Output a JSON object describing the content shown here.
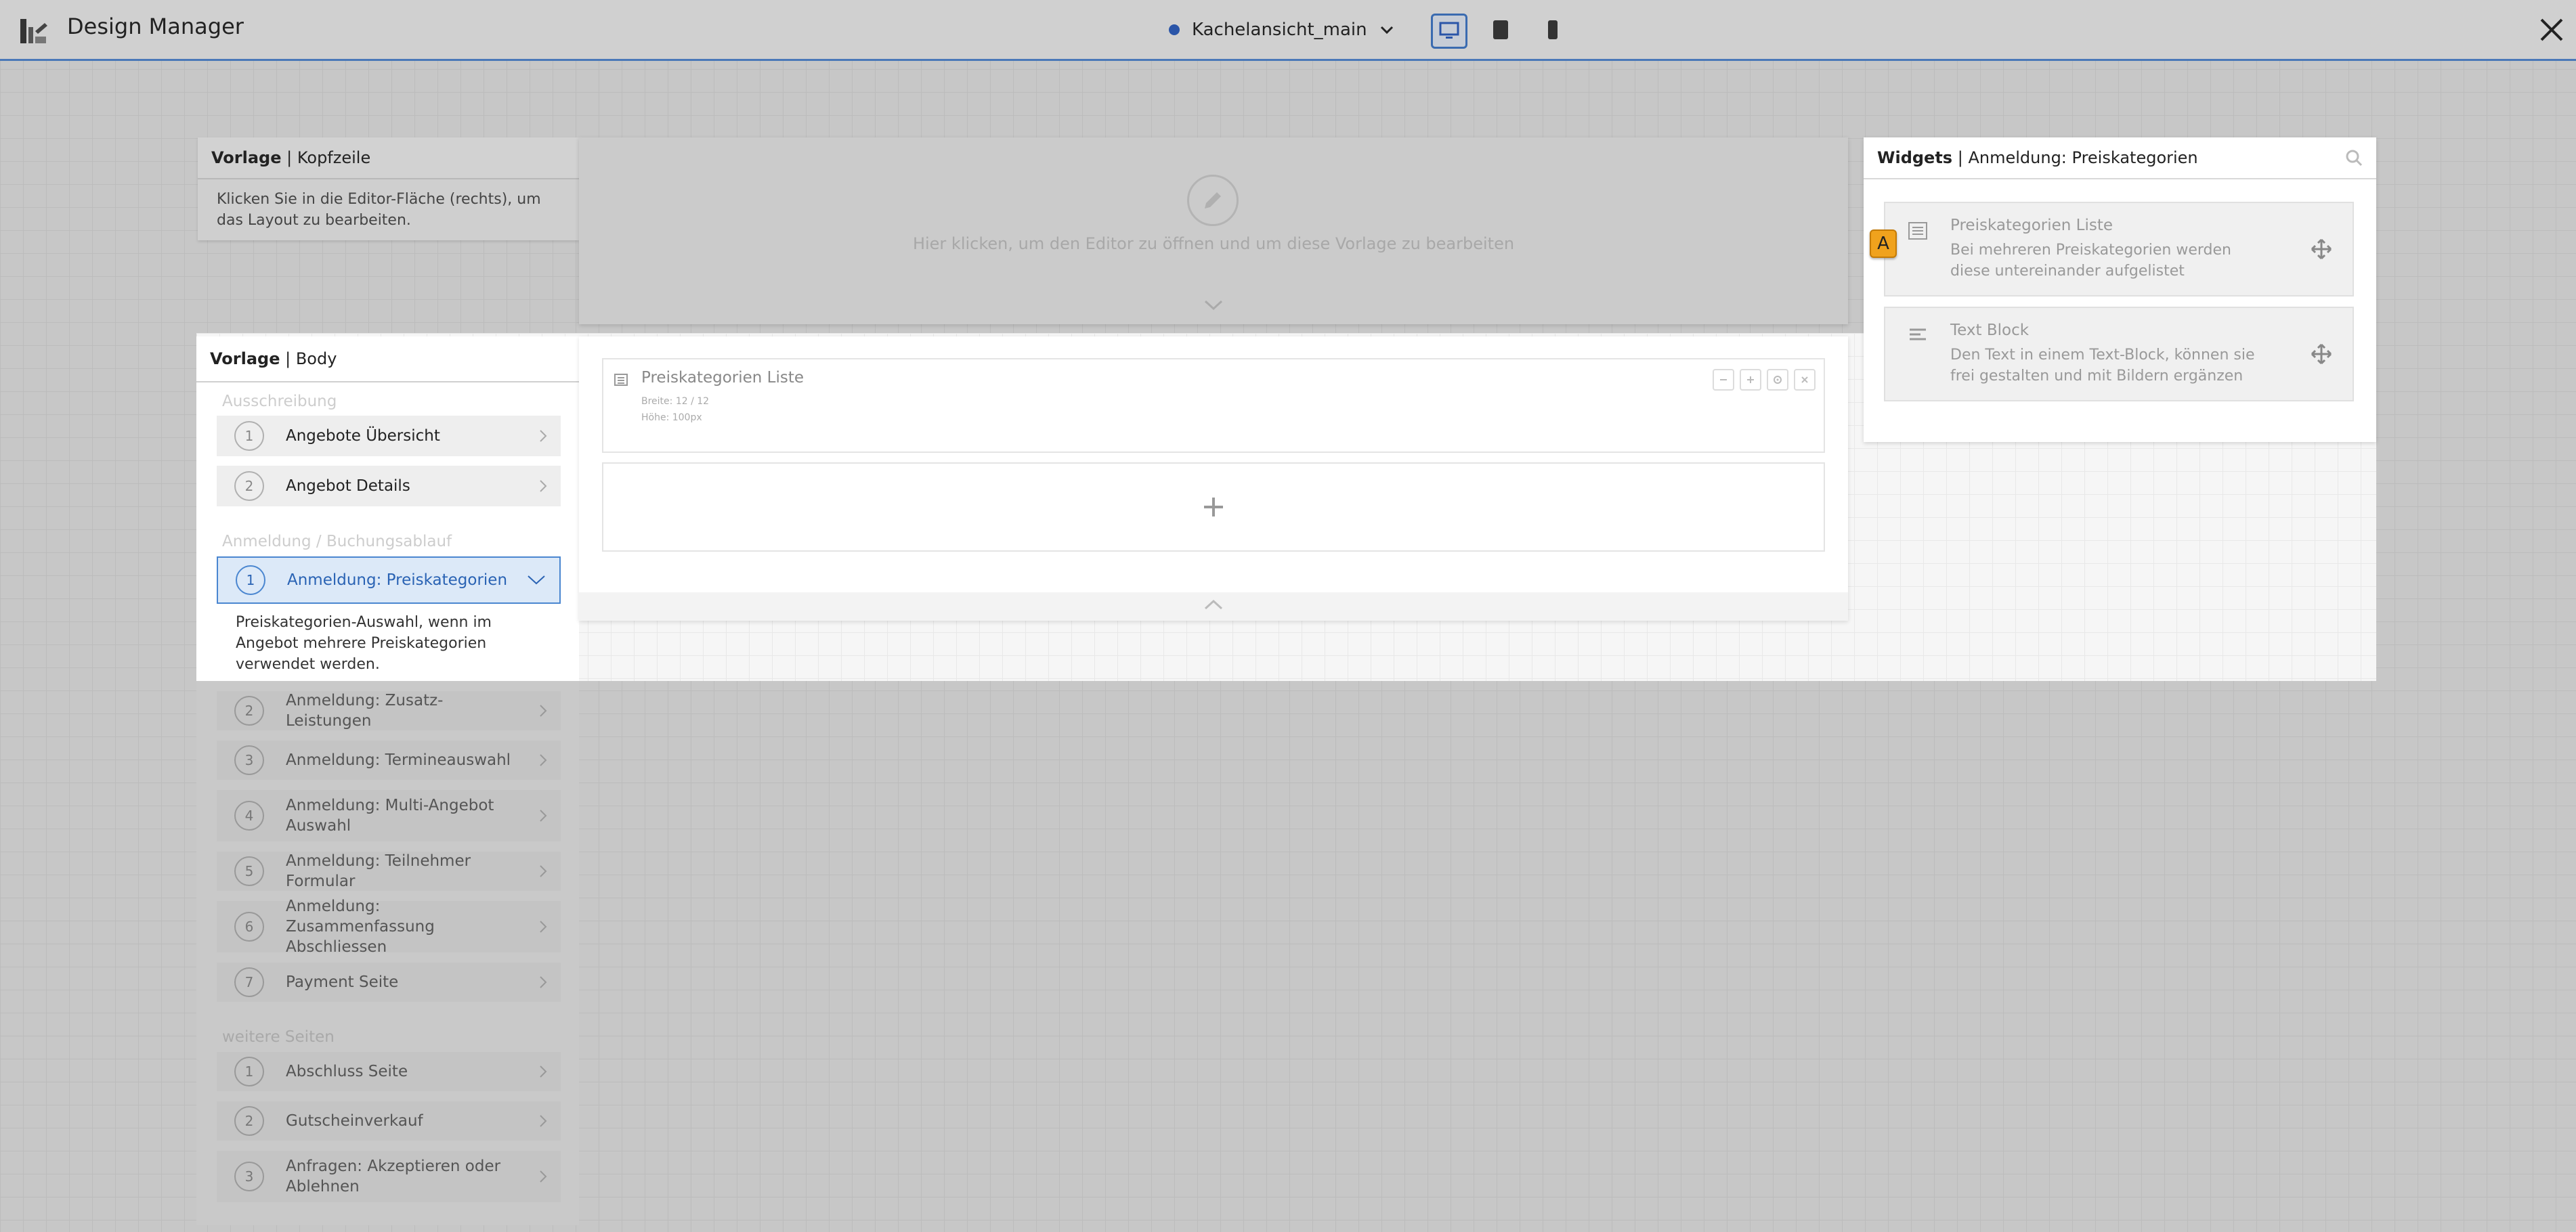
{
  "app": {
    "title": "Design Manager"
  },
  "layout_selector": {
    "value": "Kachelansicht_main"
  },
  "header_template": {
    "title_bold": "Vorlage",
    "separator": "|",
    "title_rest": "Kopfzeile",
    "description": "Klicken Sie in die Editor-Fläche (rechts), um das Layout zu bearbeiten.",
    "editor_hint": "Hier klicken, um den Editor zu öffnen und um diese Vorlage zu bearbeiten"
  },
  "body_template": {
    "title_bold": "Vorlage",
    "separator": "|",
    "title_rest": "Body"
  },
  "nav": {
    "section_1": "Ausschreibung",
    "section_1_items": [
      {
        "num": "1",
        "label": "Angebote Übersicht"
      },
      {
        "num": "2",
        "label": "Angebot Details"
      }
    ],
    "section_2": "Anmeldung / Buchungsablauf",
    "selected": {
      "num": "1",
      "label": "Anmeldung: Preiskategorien",
      "description": "Preiskategorien-Auswahl, wenn im Angebot mehrere Preiskategorien verwendet werden."
    },
    "section_2_items": [
      {
        "num": "2",
        "label": "Anmeldung: Zusatz-Leistungen"
      },
      {
        "num": "3",
        "label": "Anmeldung: Termineauswahl"
      },
      {
        "num": "4",
        "label": "Anmeldung: Multi-Angebot Auswahl"
      },
      {
        "num": "5",
        "label": "Anmeldung: Teilnehmer Formular"
      },
      {
        "num": "6",
        "label": "Anmeldung: Zusammenfassung Abschliessen"
      },
      {
        "num": "7",
        "label": "Payment Seite"
      }
    ],
    "section_3": "weitere Seiten",
    "section_3_items": [
      {
        "num": "1",
        "label": "Abschluss Seite"
      },
      {
        "num": "2",
        "label": "Gutscheinverkauf"
      },
      {
        "num": "3",
        "label": "Anfragen: Akzeptieren oder Ablehnen"
      }
    ]
  },
  "body_editor": {
    "widget_title": "Preiskategorien Liste",
    "width_label": "Breite: 12 / 12",
    "height_label": "Höhe: 100px"
  },
  "widgets_panel": {
    "title_bold": "Widgets",
    "separator": "|",
    "title_rest": "Anmeldung: Preiskategorien",
    "badge": "A",
    "items": [
      {
        "title": "Preiskategorien Liste",
        "description": "Bei mehreren Preiskategorien werden diese untereinander aufgelistet"
      },
      {
        "title": "Text Block",
        "description": "Den Text in einem Text-Block, können sie frei gestalten und mit Bildern ergänzen"
      }
    ]
  },
  "colors": {
    "accent": "#2a63b4",
    "selected_bg": "#dce9f8",
    "badge": "#f0a21d"
  }
}
